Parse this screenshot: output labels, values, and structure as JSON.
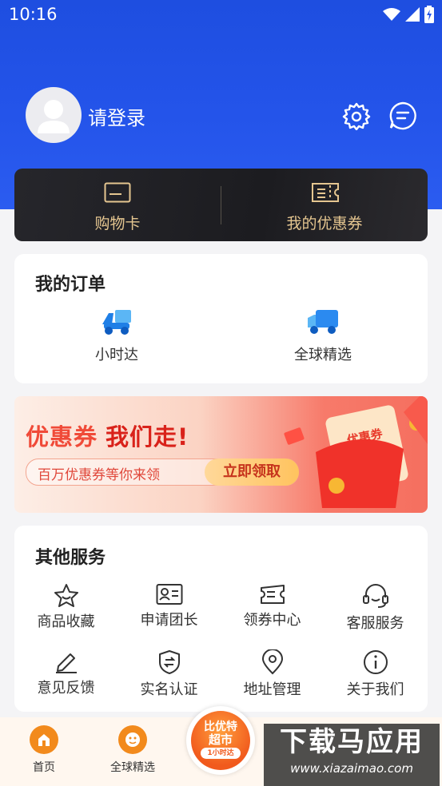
{
  "status_bar": {
    "time": "10:16"
  },
  "profile": {
    "login_text": "请登录"
  },
  "cards": {
    "shopping_card": "购物卡",
    "my_coupons": "我的优惠券"
  },
  "orders": {
    "title": "我的订单",
    "items": [
      {
        "label": "小时达",
        "icon": "scooter-icon"
      },
      {
        "label": "全球精选",
        "icon": "truck-icon"
      }
    ]
  },
  "banner": {
    "headline_part1": "优惠券",
    "headline_part2": "我们走!",
    "subtitle": "百万优惠券等你来领",
    "cta": "立即领取",
    "coupon_tag": "优惠券"
  },
  "services": {
    "title": "其他服务",
    "items": [
      {
        "label": "商品收藏",
        "icon": "star-icon"
      },
      {
        "label": "申请团长",
        "icon": "id-card-icon"
      },
      {
        "label": "领券中心",
        "icon": "ticket-icon"
      },
      {
        "label": "客服服务",
        "icon": "headset-icon"
      },
      {
        "label": "意见反馈",
        "icon": "pencil-icon"
      },
      {
        "label": "实名认证",
        "icon": "shield-icon"
      },
      {
        "label": "地址管理",
        "icon": "location-pin-icon"
      },
      {
        "label": "关于我们",
        "icon": "info-icon"
      }
    ]
  },
  "bottom_nav": {
    "home": "首页",
    "global": "全球精选",
    "center_line1": "比优特",
    "center_line2": "超市",
    "center_line3": "1小时达"
  },
  "watermark": {
    "line1": "下载马应用",
    "line2": "www.xiazaimao.com"
  },
  "colors": {
    "header_blue": "#2454ea",
    "gold": "#e5c690",
    "banner_red": "#f04a38",
    "orange": "#f28a1c"
  }
}
